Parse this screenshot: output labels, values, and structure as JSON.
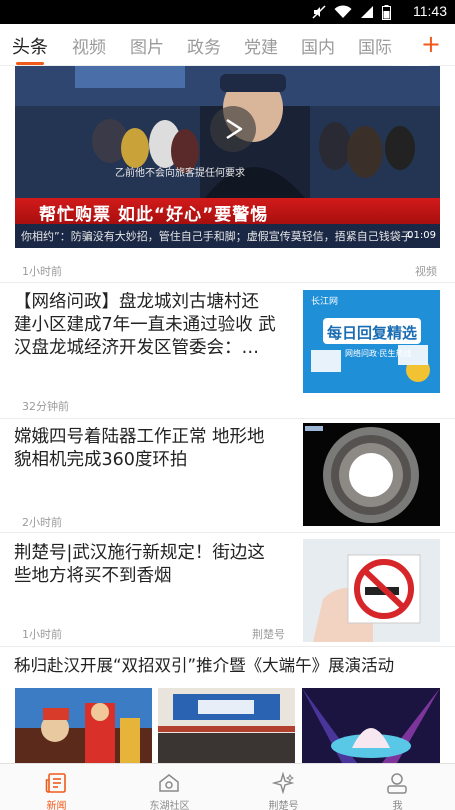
{
  "status_bar": {
    "time": "11:43"
  },
  "tabs": [
    "头条",
    "视频",
    "图片",
    "政务",
    "党建",
    "国内",
    "国际"
  ],
  "active_tab": "头条",
  "colors": {
    "accent": "#f05a1a"
  },
  "feed": {
    "video": {
      "subtitle": "乙前他不会向旅客提任何要求",
      "banner": "帮忙购票  如此“好心”要警惕",
      "ticker": "你相约”：防骗没有大妙招，管住自己手和脚；虚假宣传莫轻信，捂紧自己钱袋子",
      "duration": "01:09",
      "time": "1小时前",
      "tag": "视频"
    },
    "items": [
      {
        "title_lines": [
          "【网络问政】盘龙城刘古塘村还",
          "建小区建成7年一直未通过验收 武",
          "汉盘龙城经济开发区管委会：…"
        ],
        "time": "32分钟前",
        "thumb": {
          "logo": "长江网",
          "headline": "每日回复精选",
          "caption": "网络问政·民生热线"
        }
      },
      {
        "title_lines": [
          "嫦娥四号着陆器工作正常 地形地",
          "貌相机完成360度环拍"
        ],
        "time": "2小时前"
      },
      {
        "title_lines": [
          "荆楚号|武汉施行新规定！街边这",
          "些地方将买不到香烟"
        ],
        "time": "1小时前",
        "source": "荆楚号"
      },
      {
        "title": "秭归赴汉开展“双招双引”推介暨《大端午》展演活动"
      }
    ]
  },
  "bottom_nav": [
    {
      "label": "新闻",
      "icon": "news-icon"
    },
    {
      "label": "东湖社区",
      "icon": "community-icon"
    },
    {
      "label": "荆楚号",
      "icon": "sparkle-icon"
    },
    {
      "label": "我",
      "icon": "user-icon"
    }
  ]
}
